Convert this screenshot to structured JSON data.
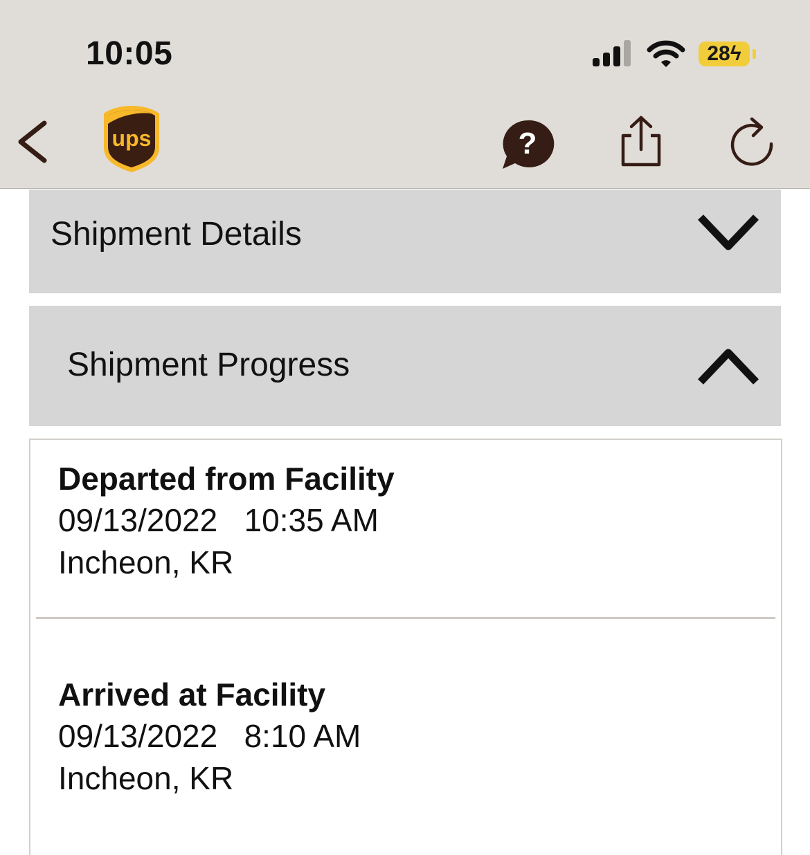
{
  "status_bar": {
    "time": "10:05",
    "battery": "28"
  },
  "nav": {
    "back_icon": "chevron-left-icon",
    "logo_text": "ups",
    "help_icon": "help-bubble-icon",
    "share_icon": "share-icon",
    "refresh_icon": "refresh-icon"
  },
  "sections": {
    "details_title": "Shipment Details",
    "progress_title": "Shipment Progress"
  },
  "events": [
    {
      "status": "Departed from Facility",
      "date": "09/13/2022",
      "time": "10:35 AM",
      "location": "Incheon, KR"
    },
    {
      "status": "Arrived at Facility",
      "date": "09/13/2022",
      "time": "8:10 AM",
      "location": "Incheon, KR"
    }
  ],
  "colors": {
    "brand_brown": "#351c15",
    "brand_gold": "#ffb500",
    "header_bg": "#e0ddd8",
    "section_bg": "#d6d6d6"
  }
}
